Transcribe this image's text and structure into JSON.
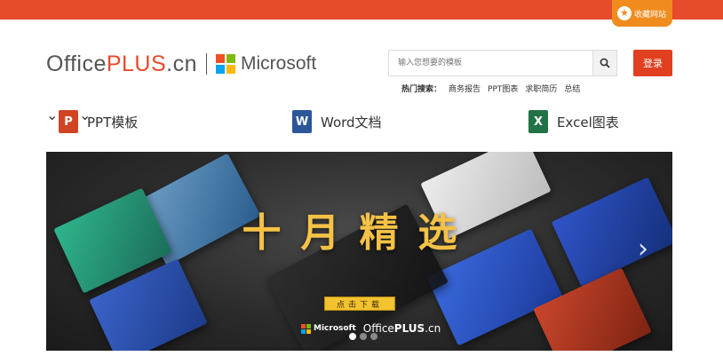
{
  "favorite": {
    "label": "收藏网站"
  },
  "logo": {
    "office": "Office",
    "plus": "PLUS",
    "cn": ".cn",
    "microsoft": "Microsoft"
  },
  "search": {
    "placeholder": "输入您想要的模板"
  },
  "login": {
    "label": "登录"
  },
  "hot_search": {
    "label": "热门搜索：",
    "items": [
      "商务报告",
      "PPT图表",
      "求职简历",
      "总结"
    ]
  },
  "categories": [
    {
      "label": "PPT模板",
      "icon": "ppt-icon",
      "letter": "P",
      "color": "#d04423"
    },
    {
      "label": "Word文档",
      "icon": "word-icon",
      "letter": "W",
      "color": "#2b579a"
    },
    {
      "label": "Excel图表",
      "icon": "excel-icon",
      "letter": "X",
      "color": "#217346"
    }
  ],
  "banner": {
    "headline": "十月精选",
    "cta": "点击下载",
    "brand_ms": "Microsoft",
    "brand_office": "Office",
    "brand_plus": "PLUS",
    "brand_cn": ".cn",
    "dots": 3,
    "active_dot": 0
  }
}
